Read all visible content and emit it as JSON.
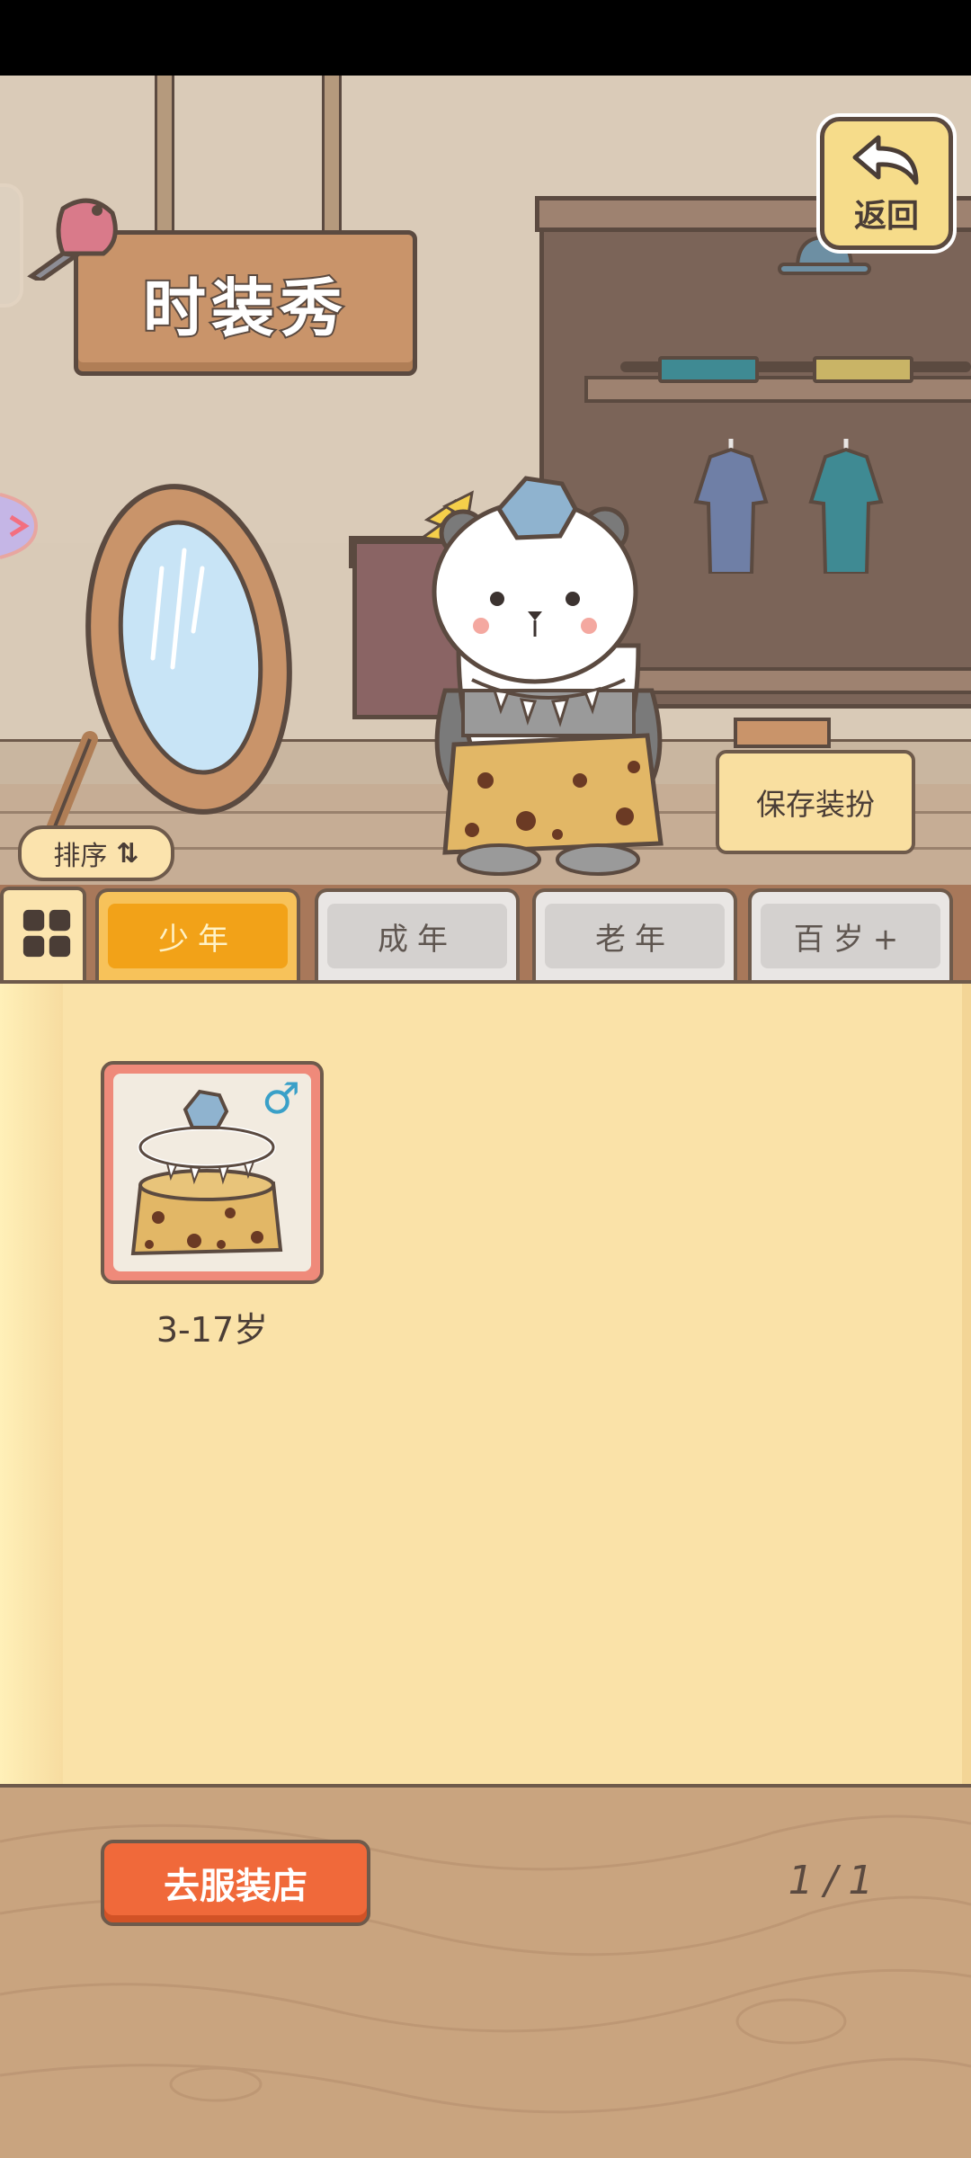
{
  "scene": {
    "sign_title": "时装秀",
    "back_label": "返回",
    "save_outfit_label": "保存装扮",
    "sort_label": "排序",
    "sort_icon": "⇅"
  },
  "tabs": [
    {
      "label": "少年",
      "active": true
    },
    {
      "label": "成年",
      "active": false
    },
    {
      "label": "老年",
      "active": false
    },
    {
      "label": "百岁+",
      "active": false
    }
  ],
  "items": [
    {
      "label": "3-17岁",
      "gender_icon": "♂"
    }
  ],
  "footer": {
    "shop_button_label": "去服装店",
    "page_indicator": "1/1"
  },
  "colors": {
    "active_tab": "#f2a218",
    "shop_button": "#f0693a",
    "panel": "#fae2a8"
  }
}
